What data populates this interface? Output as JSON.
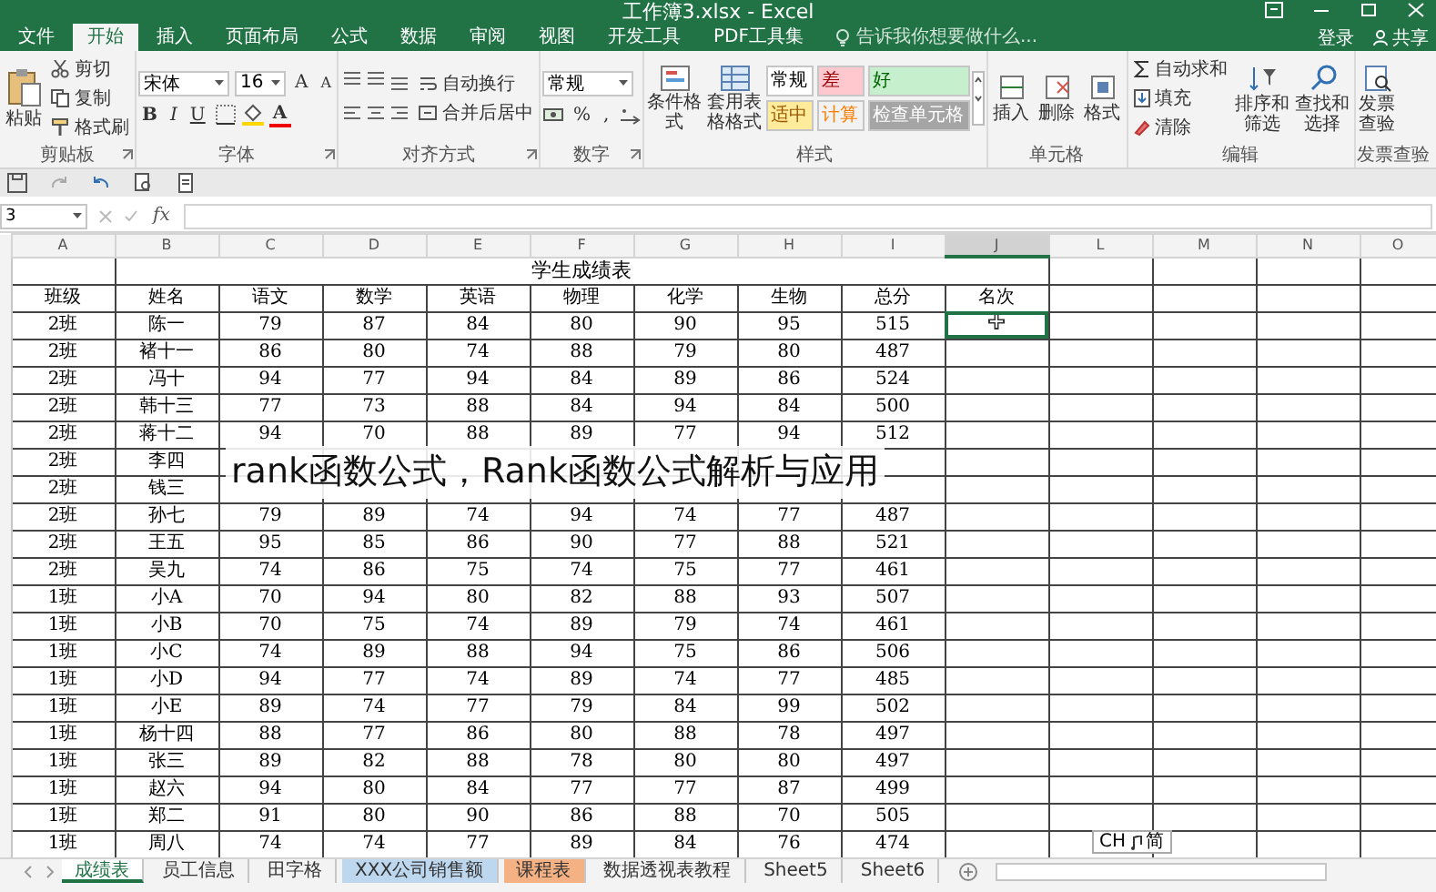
{
  "window": {
    "title": "工作簿3.xlsx - Excel",
    "sign_in": "登录",
    "share": "共享"
  },
  "tabs": [
    {
      "label": "文件",
      "selected": false
    },
    {
      "label": "开始",
      "selected": true
    },
    {
      "label": "插入",
      "selected": false
    },
    {
      "label": "页面布局",
      "selected": false
    },
    {
      "label": "公式",
      "selected": false
    },
    {
      "label": "数据",
      "selected": false
    },
    {
      "label": "审阅",
      "selected": false
    },
    {
      "label": "视图",
      "selected": false
    },
    {
      "label": "开发工具",
      "selected": false
    },
    {
      "label": "PDF工具集",
      "selected": false
    }
  ],
  "tell_me": {
    "placeholder": "告诉我你想要做什么..."
  },
  "ribbon": {
    "clipboard": {
      "label": "剪贴板",
      "paste": "粘贴",
      "cut": "剪切",
      "copy": "复制",
      "painter": "格式刷"
    },
    "font": {
      "label": "字体",
      "family": "宋体",
      "size": "16",
      "grow": "A",
      "shrink": "A",
      "bold": "B",
      "italic": "I",
      "underline": "U",
      "color_letter": "A"
    },
    "alignment": {
      "label": "对齐方式",
      "wrap": "自动换行",
      "merge": "合并后居中"
    },
    "number": {
      "label": "数字",
      "format": "常规",
      "percent": "%",
      "comma": ","
    },
    "styles": {
      "label": "样式",
      "conditional": "条件格式",
      "table": "套用表格格式",
      "cells": [
        {
          "label": "常规",
          "color": "#ffffff"
        },
        {
          "label": "差",
          "color": "#ffc7ce"
        },
        {
          "label": "好",
          "color": "#c6efce"
        },
        {
          "label": "适中",
          "color": "#ffeb9c"
        },
        {
          "label": "计算",
          "color": "#f2f2f2"
        },
        {
          "label": "检查单元格",
          "color": "#a5a5a5"
        }
      ]
    },
    "cells": {
      "label": "单元格",
      "insert": "插入",
      "delete": "删除",
      "format": "格式"
    },
    "editing": {
      "label": "编辑",
      "autosum": "自动求和",
      "fill": "填充",
      "clear": "清除",
      "sort": "排序和筛选",
      "find": "查找和选择"
    },
    "invoice": {
      "label": "发票查验",
      "check": "发票查验"
    }
  },
  "formula_bar": {
    "name_box": "3",
    "function_label": "fx"
  },
  "sheet": {
    "columns": [
      "A",
      "B",
      "C",
      "D",
      "E",
      "F",
      "G",
      "H",
      "I",
      "J",
      "L",
      "M",
      "N",
      "O"
    ],
    "title": "学生成绩表",
    "headers": [
      "班级",
      "姓名",
      "语文",
      "数学",
      "英语",
      "物理",
      "化学",
      "生物",
      "总分",
      "名次"
    ],
    "rows": [
      {
        "cells": [
          "2班",
          "陈一",
          "79",
          "87",
          "84",
          "80",
          "90",
          "95",
          "515"
        ],
        "selected": true
      },
      {
        "cells": [
          "2班",
          "褚十一",
          "86",
          "80",
          "74",
          "88",
          "79",
          "80",
          "487"
        ],
        "selected": false
      },
      {
        "cells": [
          "2班",
          "冯十",
          "94",
          "77",
          "94",
          "84",
          "89",
          "86",
          "524"
        ],
        "selected": false
      },
      {
        "cells": [
          "2班",
          "韩十三",
          "77",
          "73",
          "88",
          "84",
          "94",
          "84",
          "500"
        ],
        "selected": false
      },
      {
        "cells": [
          "2班",
          "蒋十二",
          "94",
          "70",
          "88",
          "89",
          "77",
          "94",
          "512"
        ],
        "selected": false
      },
      {
        "cells": [
          "2班",
          "李四",
          null,
          null,
          null,
          null,
          null,
          null,
          null
        ],
        "selected": false
      },
      {
        "cells": [
          "2班",
          "钱三",
          null,
          null,
          null,
          null,
          null,
          null,
          null
        ],
        "selected": false
      },
      {
        "cells": [
          "2班",
          "孙七",
          "79",
          "89",
          "74",
          "94",
          "74",
          "77",
          "487"
        ],
        "selected": false
      },
      {
        "cells": [
          "2班",
          "王五",
          "95",
          "85",
          "86",
          "90",
          "77",
          "88",
          "521"
        ],
        "selected": false
      },
      {
        "cells": [
          "2班",
          "吴九",
          "74",
          "86",
          "75",
          "74",
          "75",
          "77",
          "461"
        ],
        "selected": false
      },
      {
        "cells": [
          "1班",
          "小A",
          "70",
          "94",
          "80",
          "82",
          "88",
          "93",
          "507"
        ],
        "selected": false
      },
      {
        "cells": [
          "1班",
          "小B",
          "70",
          "75",
          "74",
          "89",
          "79",
          "74",
          "461"
        ],
        "selected": false
      },
      {
        "cells": [
          "1班",
          "小C",
          "74",
          "89",
          "88",
          "94",
          "75",
          "86",
          "506"
        ],
        "selected": false
      },
      {
        "cells": [
          "1班",
          "小D",
          "94",
          "77",
          "74",
          "89",
          "74",
          "77",
          "485"
        ],
        "selected": false
      },
      {
        "cells": [
          "1班",
          "小E",
          "89",
          "74",
          "77",
          "79",
          "84",
          "99",
          "502"
        ],
        "selected": false
      },
      {
        "cells": [
          "1班",
          "杨十四",
          "88",
          "77",
          "86",
          "80",
          "88",
          "78",
          "497"
        ],
        "selected": false
      },
      {
        "cells": [
          "1班",
          "张三",
          "89",
          "82",
          "88",
          "78",
          "80",
          "80",
          "497"
        ],
        "selected": false
      },
      {
        "cells": [
          "1班",
          "赵六",
          "94",
          "80",
          "84",
          "77",
          "77",
          "87",
          "499"
        ],
        "selected": false
      },
      {
        "cells": [
          "1班",
          "郑二",
          "91",
          "80",
          "90",
          "86",
          "88",
          "70",
          "505"
        ],
        "selected": false
      },
      {
        "cells": [
          "1班",
          "周八",
          "74",
          "74",
          "77",
          "89",
          "84",
          "76",
          "474"
        ],
        "selected": false
      }
    ]
  },
  "caption": "rank函数公式，Rank函数公式解析与应用",
  "ime": {
    "lang": "CH",
    "mode": "简"
  },
  "sheet_tabs": [
    {
      "label": "成绩表",
      "selected": true
    },
    {
      "label": "员工信息",
      "selected": false
    },
    {
      "label": "田字格",
      "selected": false
    },
    {
      "label": "XXX公司销售额",
      "selected": false,
      "color": "#bdd7ee"
    },
    {
      "label": "课程表",
      "selected": false,
      "color": "#f4b183"
    },
    {
      "label": "数据透视表教程",
      "selected": false
    },
    {
      "label": "Sheet5",
      "selected": false
    },
    {
      "label": "Sheet6",
      "selected": false
    }
  ]
}
